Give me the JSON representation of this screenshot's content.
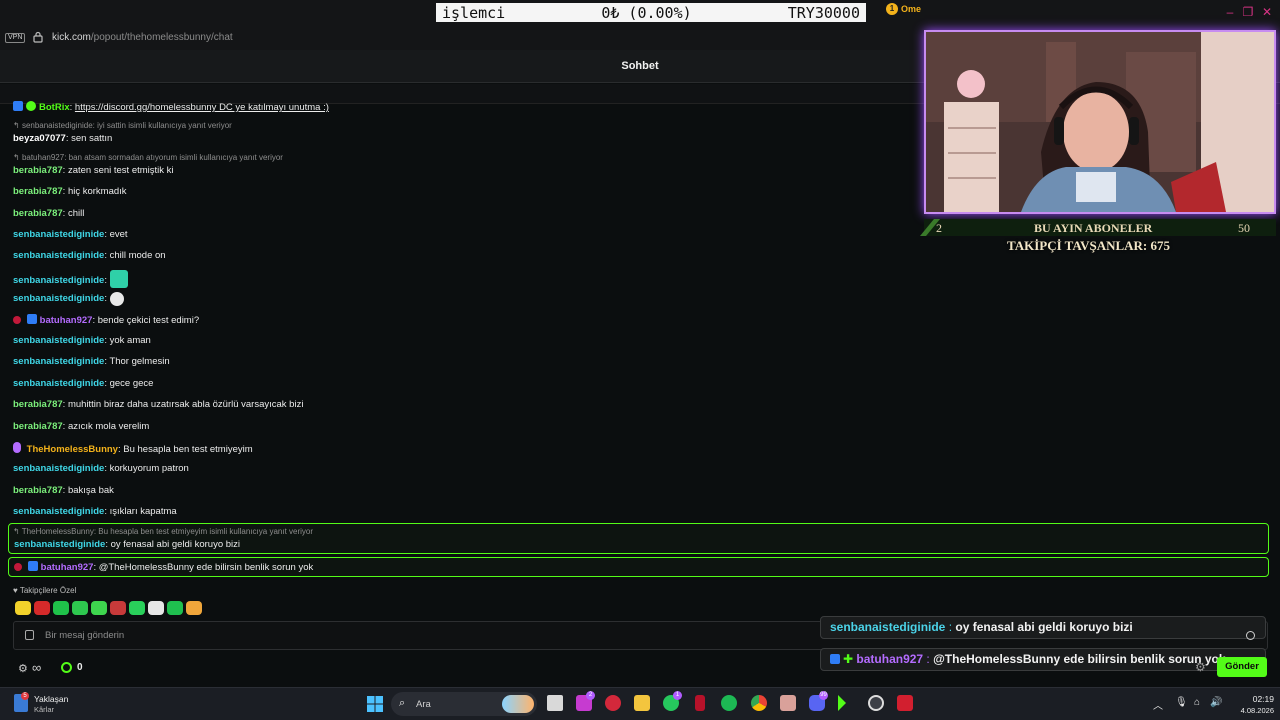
{
  "browser": {
    "vpn": "VPN",
    "url_host": "kick.com",
    "url_path": "/popout/thehomelessbunny/chat"
  },
  "ticker": {
    "left": "işlemci",
    "middle": "0₺ (0.00%)",
    "right": "TRY30000"
  },
  "chat": {
    "title": "Sohbet",
    "pinned_name": "Ome",
    "top_message": {
      "user": "BotRix",
      "text": "https://discord.gg/homelessbunny DC ye katılmayı unutma :)"
    },
    "messages": [
      {
        "reply": "senbanaistediginide: iyi sattin isimli kullanıcıya yanıt veriyor"
      },
      {
        "user": "beyza07077",
        "text": "sen sattın"
      },
      {
        "reply": "batuhan927: ban atsam sormadan atıyorum isimli kullanıcıya yanıt veriyor"
      },
      {
        "user": "berabia787",
        "text": "zaten seni test etmiştik ki"
      },
      {
        "user": "berabia787",
        "text": "hiç korkmadık"
      },
      {
        "user": "berabia787",
        "text": "chill"
      },
      {
        "user": "senbanaistediginide",
        "text": "evet"
      },
      {
        "user": "senbanaistediginide",
        "text": "chill mode on"
      },
      {
        "user": "senbanaistediginide",
        "text": ""
      },
      {
        "user": "senbanaistediginide",
        "text": ""
      },
      {
        "user": "batuhan927",
        "text": "bende çekici test edimi?"
      },
      {
        "user": "senbanaistediginide",
        "text": "yok aman"
      },
      {
        "user": "senbanaistediginide",
        "text": "Thor gelmesin"
      },
      {
        "user": "senbanaistediginide",
        "text": "gece gece"
      },
      {
        "user": "berabia787",
        "text": "muhittin biraz daha uzatırsak abla özürlü varsayıcak bizi"
      },
      {
        "user": "berabia787",
        "text": "azıcık mola verelim"
      },
      {
        "user": "TheHomelessBunny",
        "text": "Bu hesapla ben test etmiyeyim"
      },
      {
        "user": "senbanaistediginide",
        "text": "korkuyorum patron"
      },
      {
        "user": "berabia787",
        "text": "bakışa bak"
      },
      {
        "user": "senbanaistediginide",
        "text": "ışıkları kapatma"
      }
    ],
    "highlight_1": {
      "reply": "TheHomelessBunny: Bu hesapla ben test etmiyeyim isimli kullanıcıya yanıt veriyor",
      "user": "senbanaistediginide",
      "text": "oy fenasal abi geldi koruyo bizi"
    },
    "highlight_2": {
      "user": "batuhan927",
      "text": "@TheHomelessBunny ede bilirsin benlik sorun yok"
    },
    "follower_only": "Takipçilere Özel",
    "input_placeholder": "Bir mesaj gönderin",
    "points": "0",
    "send_label": "Gönder"
  },
  "overlay": {
    "sub_left": "2",
    "sub_title": "BU AYIN ABONELER",
    "sub_right": "50",
    "follower_goal": "TAKİPÇİ TAVŞANLAR: 675",
    "chat_1": {
      "user": "senbanaistediginide",
      "sep": " : ",
      "text": "oy fenasal abi geldi koruyo bizi"
    },
    "chat_2": {
      "user": "batuhan927",
      "sep": " : ",
      "text": "@TheHomelessBunny ede bilirsin benlik sorun yok"
    }
  },
  "taskbar": {
    "weather_title": "Yaklaşan",
    "weather_sub": "Kârlar",
    "weather_badge": "5",
    "search": "Ara",
    "badges": {
      "app1": "2",
      "app2": "1",
      "app3": "99"
    },
    "time": "02:19",
    "date": "4.08.2026"
  },
  "colors": {
    "accent": "#53fc18",
    "overlay_glow": "#9b4dff"
  }
}
